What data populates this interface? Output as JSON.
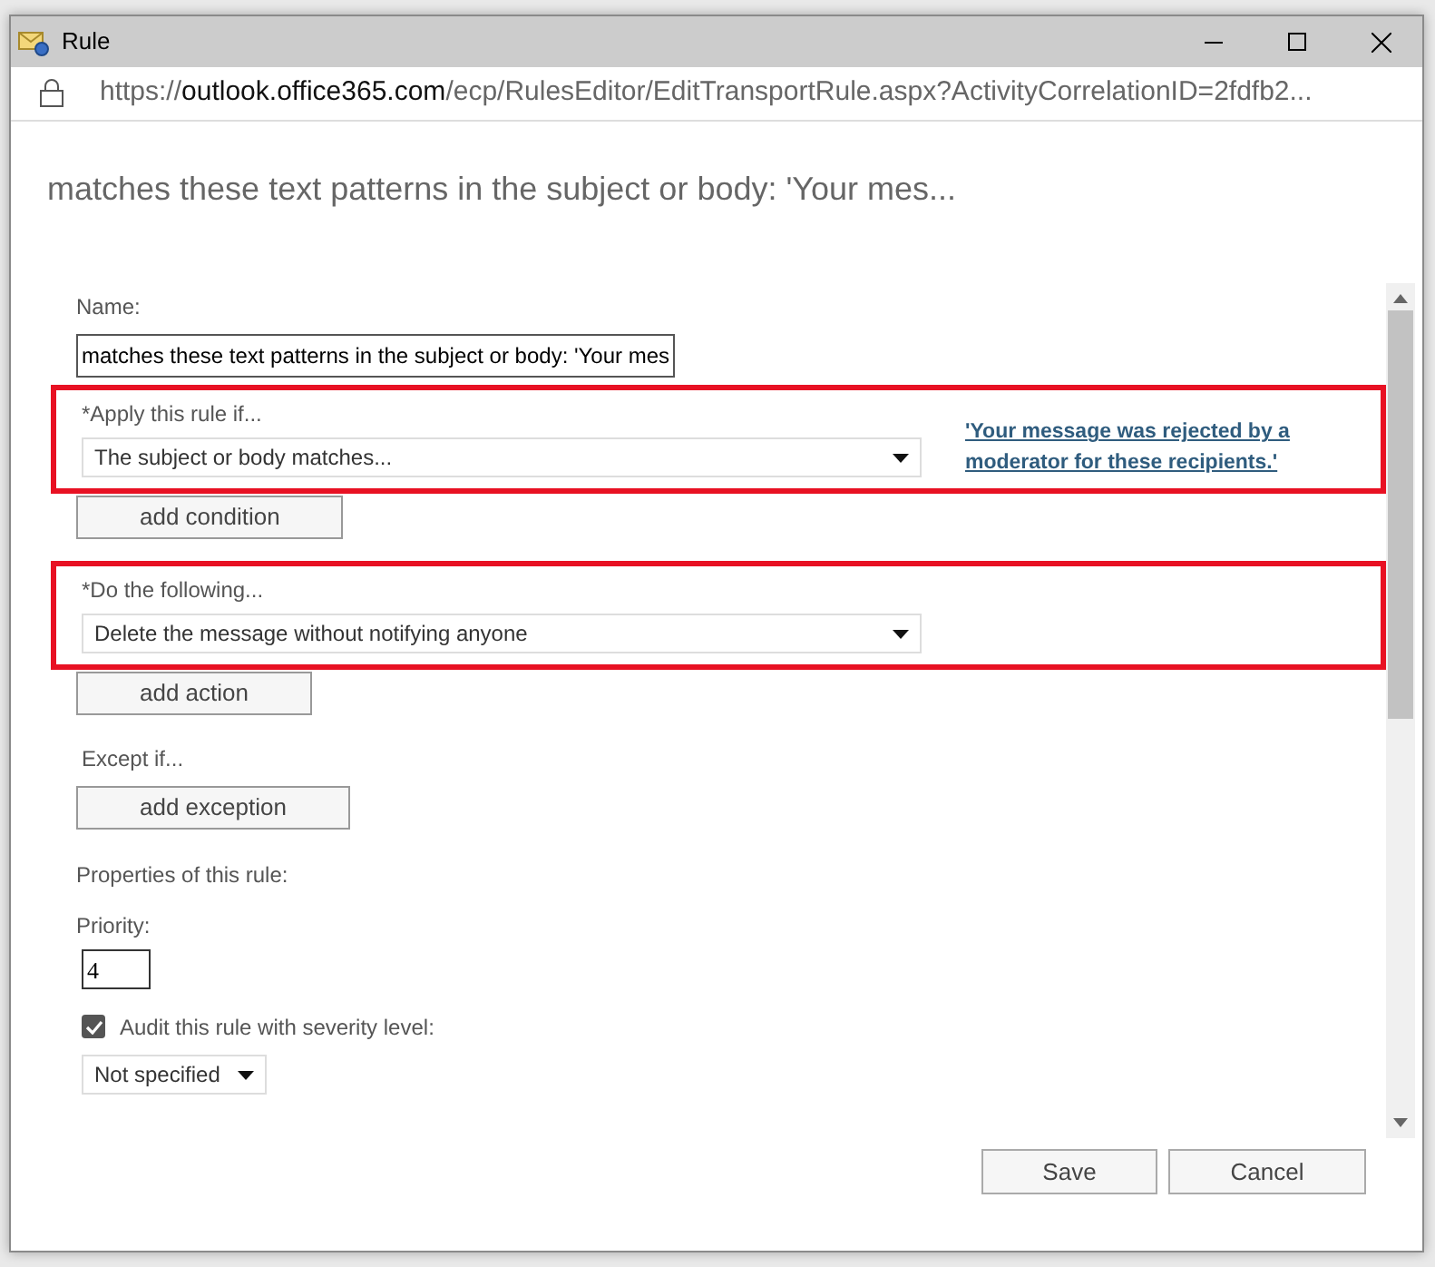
{
  "window": {
    "title": "Rule"
  },
  "address": {
    "scheme": "https://",
    "host": "outlook.office365.com",
    "path": "/ecp/RulesEditor/EditTransportRule.aspx?ActivityCorrelationID=2fdfb2..."
  },
  "heading": "matches these text patterns in the subject or body: 'Your mes...",
  "name": {
    "label": "Name:",
    "value": "matches these text patterns in the subject or body: 'Your mes"
  },
  "sections": [
    {
      "label": "*Apply this rule if...",
      "select": "The subject or body matches...",
      "link": "'Your message was rejected by a moderator for these recipients.'",
      "button": "add condition",
      "highlighted": true
    },
    {
      "label": "*Do the following...",
      "select": "Delete the message without notifying anyone",
      "button": "add action",
      "highlighted": true
    },
    {
      "label": "Except if...",
      "button": "add exception",
      "highlighted": false
    }
  ],
  "properties_label": "Properties of this rule:",
  "priority": {
    "label": "Priority:",
    "value": "4"
  },
  "audit": {
    "label": "Audit this rule with severity level:",
    "checked": true,
    "severity": "Not specified"
  },
  "buttons": [
    "Save",
    "Cancel"
  ]
}
